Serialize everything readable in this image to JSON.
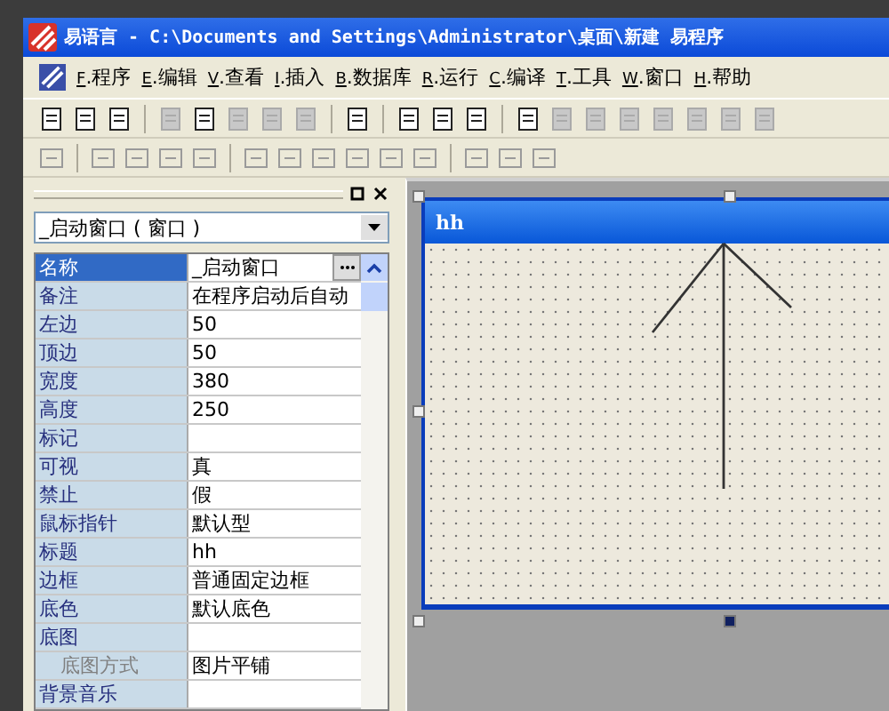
{
  "window": {
    "title": "易语言 - C:\\Documents and Settings\\Administrator\\桌面\\新建 易程序"
  },
  "menu": [
    {
      "key": "F",
      "label": ".程序"
    },
    {
      "key": "E",
      "label": ".编辑"
    },
    {
      "key": "V",
      "label": ".查看"
    },
    {
      "key": "I",
      "label": ".插入"
    },
    {
      "key": "B",
      "label": ".数据库"
    },
    {
      "key": "R",
      "label": ".运行"
    },
    {
      "key": "C",
      "label": ".编译"
    },
    {
      "key": "T",
      "label": ".工具"
    },
    {
      "key": "W",
      "label": ".窗口"
    },
    {
      "key": "H",
      "label": ".帮助"
    }
  ],
  "toolbar": [
    {
      "disabled": false
    },
    {
      "disabled": false
    },
    {
      "disabled": false
    },
    {
      "disabled": true
    },
    {
      "disabled": false
    },
    {
      "disabled": true
    },
    {
      "disabled": true
    },
    {
      "disabled": true
    },
    {
      "disabled": false
    },
    {
      "disabled": false
    },
    {
      "disabled": false
    },
    {
      "disabled": false
    },
    {
      "disabled": false
    },
    {
      "disabled": true
    },
    {
      "disabled": true
    },
    {
      "disabled": true
    },
    {
      "disabled": true
    },
    {
      "disabled": true
    },
    {
      "disabled": true
    },
    {
      "disabled": true
    }
  ],
  "properties": {
    "object": "_启动窗口 ( 窗口 )",
    "rows": [
      {
        "name": "名称",
        "value": "_启动窗口",
        "selected": true
      },
      {
        "name": "备注",
        "value": "在程序启动后自动",
        "selected": false
      },
      {
        "name": "左边",
        "value": "50",
        "selected": false
      },
      {
        "name": "顶边",
        "value": "50",
        "selected": false
      },
      {
        "name": "宽度",
        "value": "380",
        "selected": false
      },
      {
        "name": "高度",
        "value": "250",
        "selected": false
      },
      {
        "name": "标记",
        "value": "",
        "selected": false
      },
      {
        "name": "可视",
        "value": "真",
        "selected": false
      },
      {
        "name": "禁止",
        "value": "假",
        "selected": false
      },
      {
        "name": "鼠标指针",
        "value": "默认型",
        "selected": false
      },
      {
        "name": "标题",
        "value": "hh",
        "selected": false
      },
      {
        "name": "边框",
        "value": "普通固定边框",
        "selected": false
      },
      {
        "name": "底色",
        "value": "默认底色",
        "selected": false
      },
      {
        "name": "底图",
        "value": "",
        "selected": false,
        "children": [
          {
            "name": "底图方式",
            "value": "图片平铺",
            "selected": false
          }
        ]
      },
      {
        "name": "背景音乐",
        "value": "",
        "selected": false
      }
    ]
  },
  "form": {
    "title": "hh"
  }
}
